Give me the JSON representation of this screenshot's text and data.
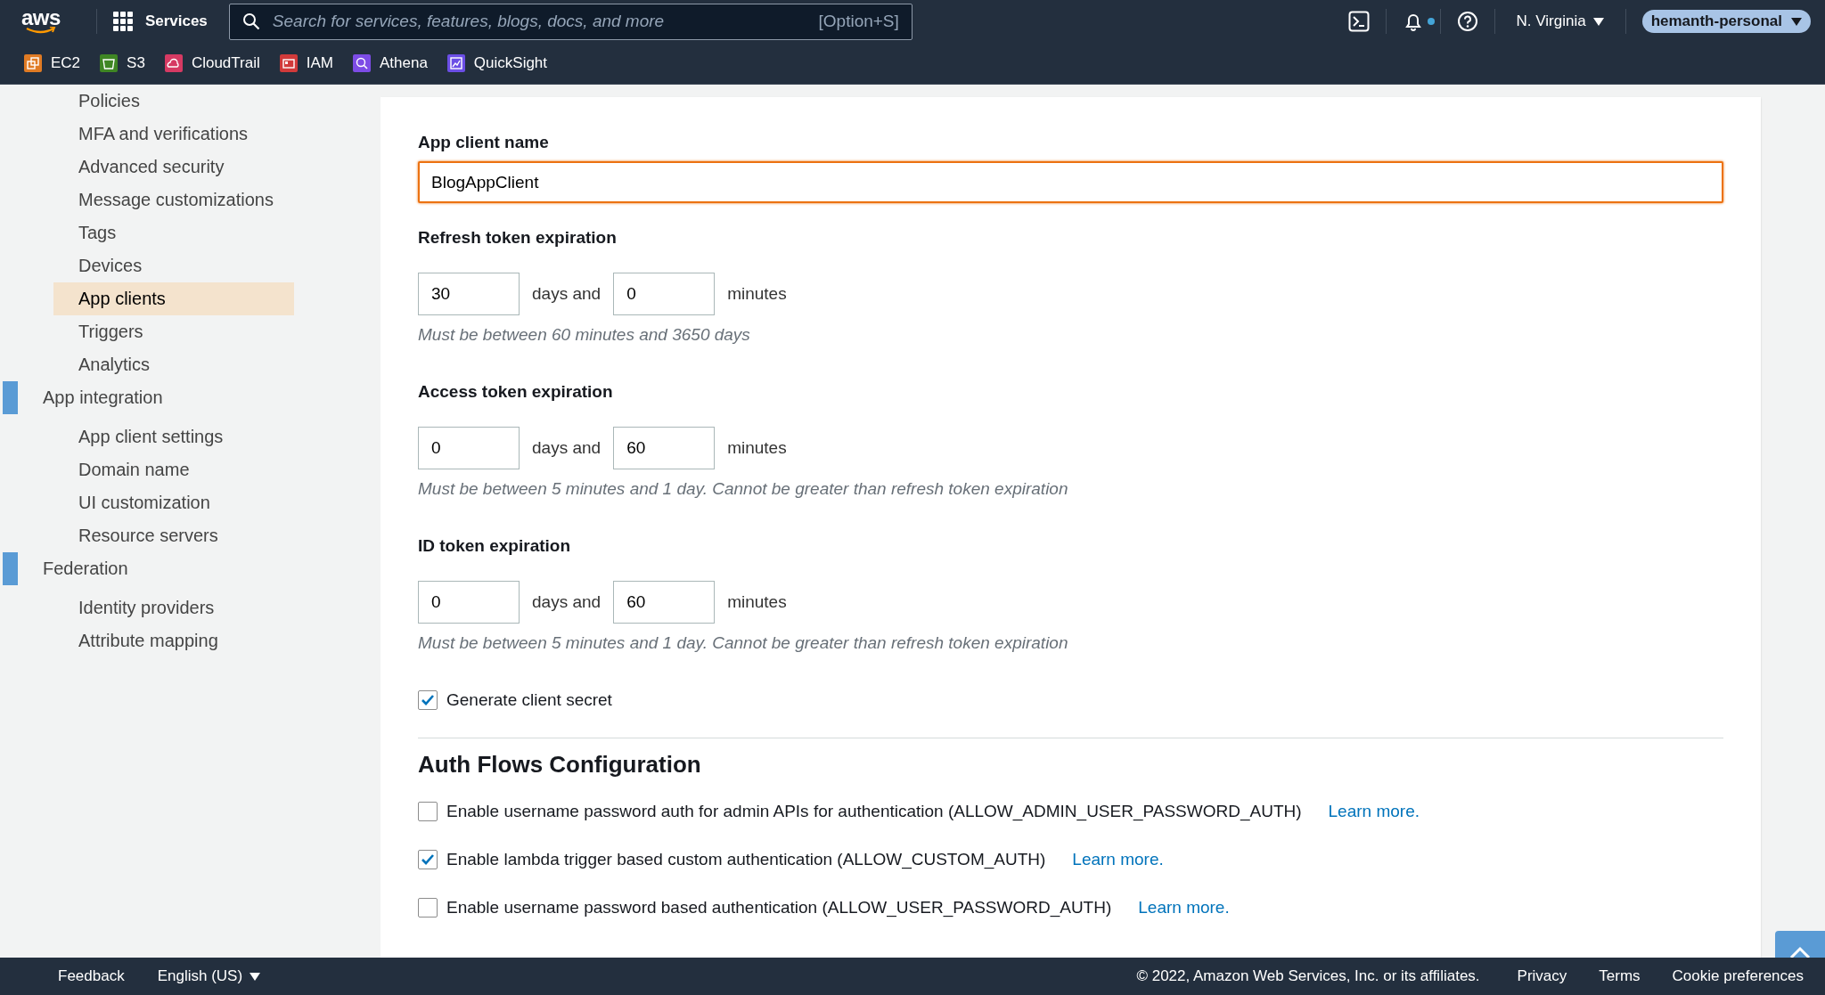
{
  "top_bar": {
    "logo": "aws",
    "services_label": "Services",
    "search": {
      "placeholder": "Search for services, features, blogs, docs, and more",
      "shortcut": "[Option+S]"
    },
    "notification_dot": true,
    "region": "N. Virginia",
    "account": "hemanth-personal"
  },
  "favorites": [
    {
      "label": "EC2",
      "color": "#e07b24"
    },
    {
      "label": "S3",
      "color": "#3f8624"
    },
    {
      "label": "CloudTrail",
      "color": "#d63a63"
    },
    {
      "label": "IAM",
      "color": "#d13a3a"
    },
    {
      "label": "Athena",
      "color": "#7d4ce6"
    },
    {
      "label": "QuickSight",
      "color": "#6b4ee6"
    }
  ],
  "sidebar": {
    "sections": [
      {
        "items": [
          {
            "label": "Policies",
            "selected": false
          },
          {
            "label": "MFA and verifications",
            "selected": false
          },
          {
            "label": "Advanced security",
            "selected": false
          },
          {
            "label": "Message customizations",
            "selected": false
          },
          {
            "label": "Tags",
            "selected": false
          },
          {
            "label": "Devices",
            "selected": false
          },
          {
            "label": "App clients",
            "selected": true
          },
          {
            "label": "Triggers",
            "selected": false
          },
          {
            "label": "Analytics",
            "selected": false
          }
        ]
      },
      {
        "label": "App integration",
        "items": [
          {
            "label": "App client settings",
            "selected": false
          },
          {
            "label": "Domain name",
            "selected": false
          },
          {
            "label": "UI customization",
            "selected": false
          },
          {
            "label": "Resource servers",
            "selected": false
          }
        ]
      },
      {
        "label": "Federation",
        "items": [
          {
            "label": "Identity providers",
            "selected": false
          },
          {
            "label": "Attribute mapping",
            "selected": false
          }
        ]
      }
    ]
  },
  "form": {
    "client_name": {
      "label": "App client name",
      "value": "BlogAppClient"
    },
    "expirations": [
      {
        "label": "Refresh token expiration",
        "days": "30",
        "days_unit": "days and",
        "minutes": "0",
        "minutes_unit": "minutes",
        "help": "Must be between 60 minutes and 3650 days"
      },
      {
        "label": "Access token expiration",
        "days": "0",
        "days_unit": "days and",
        "minutes": "60",
        "minutes_unit": "minutes",
        "help": "Must be between 5 minutes and 1 day. Cannot be greater than refresh token expiration"
      },
      {
        "label": "ID token expiration",
        "days": "0",
        "days_unit": "days and",
        "minutes": "60",
        "minutes_unit": "minutes",
        "help": "Must be between 5 minutes and 1 day. Cannot be greater than refresh token expiration"
      }
    ],
    "generate_secret": {
      "label": "Generate client secret",
      "checked": true
    },
    "auth_flows": {
      "title": "Auth Flows Configuration",
      "options": [
        {
          "label": "Enable username password auth for admin APIs for authentication (ALLOW_ADMIN_USER_PASSWORD_AUTH)",
          "checked": false,
          "link": "Learn more."
        },
        {
          "label": "Enable lambda trigger based custom authentication (ALLOW_CUSTOM_AUTH)",
          "checked": true,
          "link": "Learn more."
        },
        {
          "label": "Enable username password based authentication (ALLOW_USER_PASSWORD_AUTH)",
          "checked": false,
          "link": "Learn more."
        }
      ]
    }
  },
  "footer": {
    "feedback": "Feedback",
    "language": "English (US)",
    "copyright": "© 2022, Amazon Web Services, Inc. or its affiliates.",
    "links": [
      "Privacy",
      "Terms",
      "Cookie preferences"
    ]
  }
}
